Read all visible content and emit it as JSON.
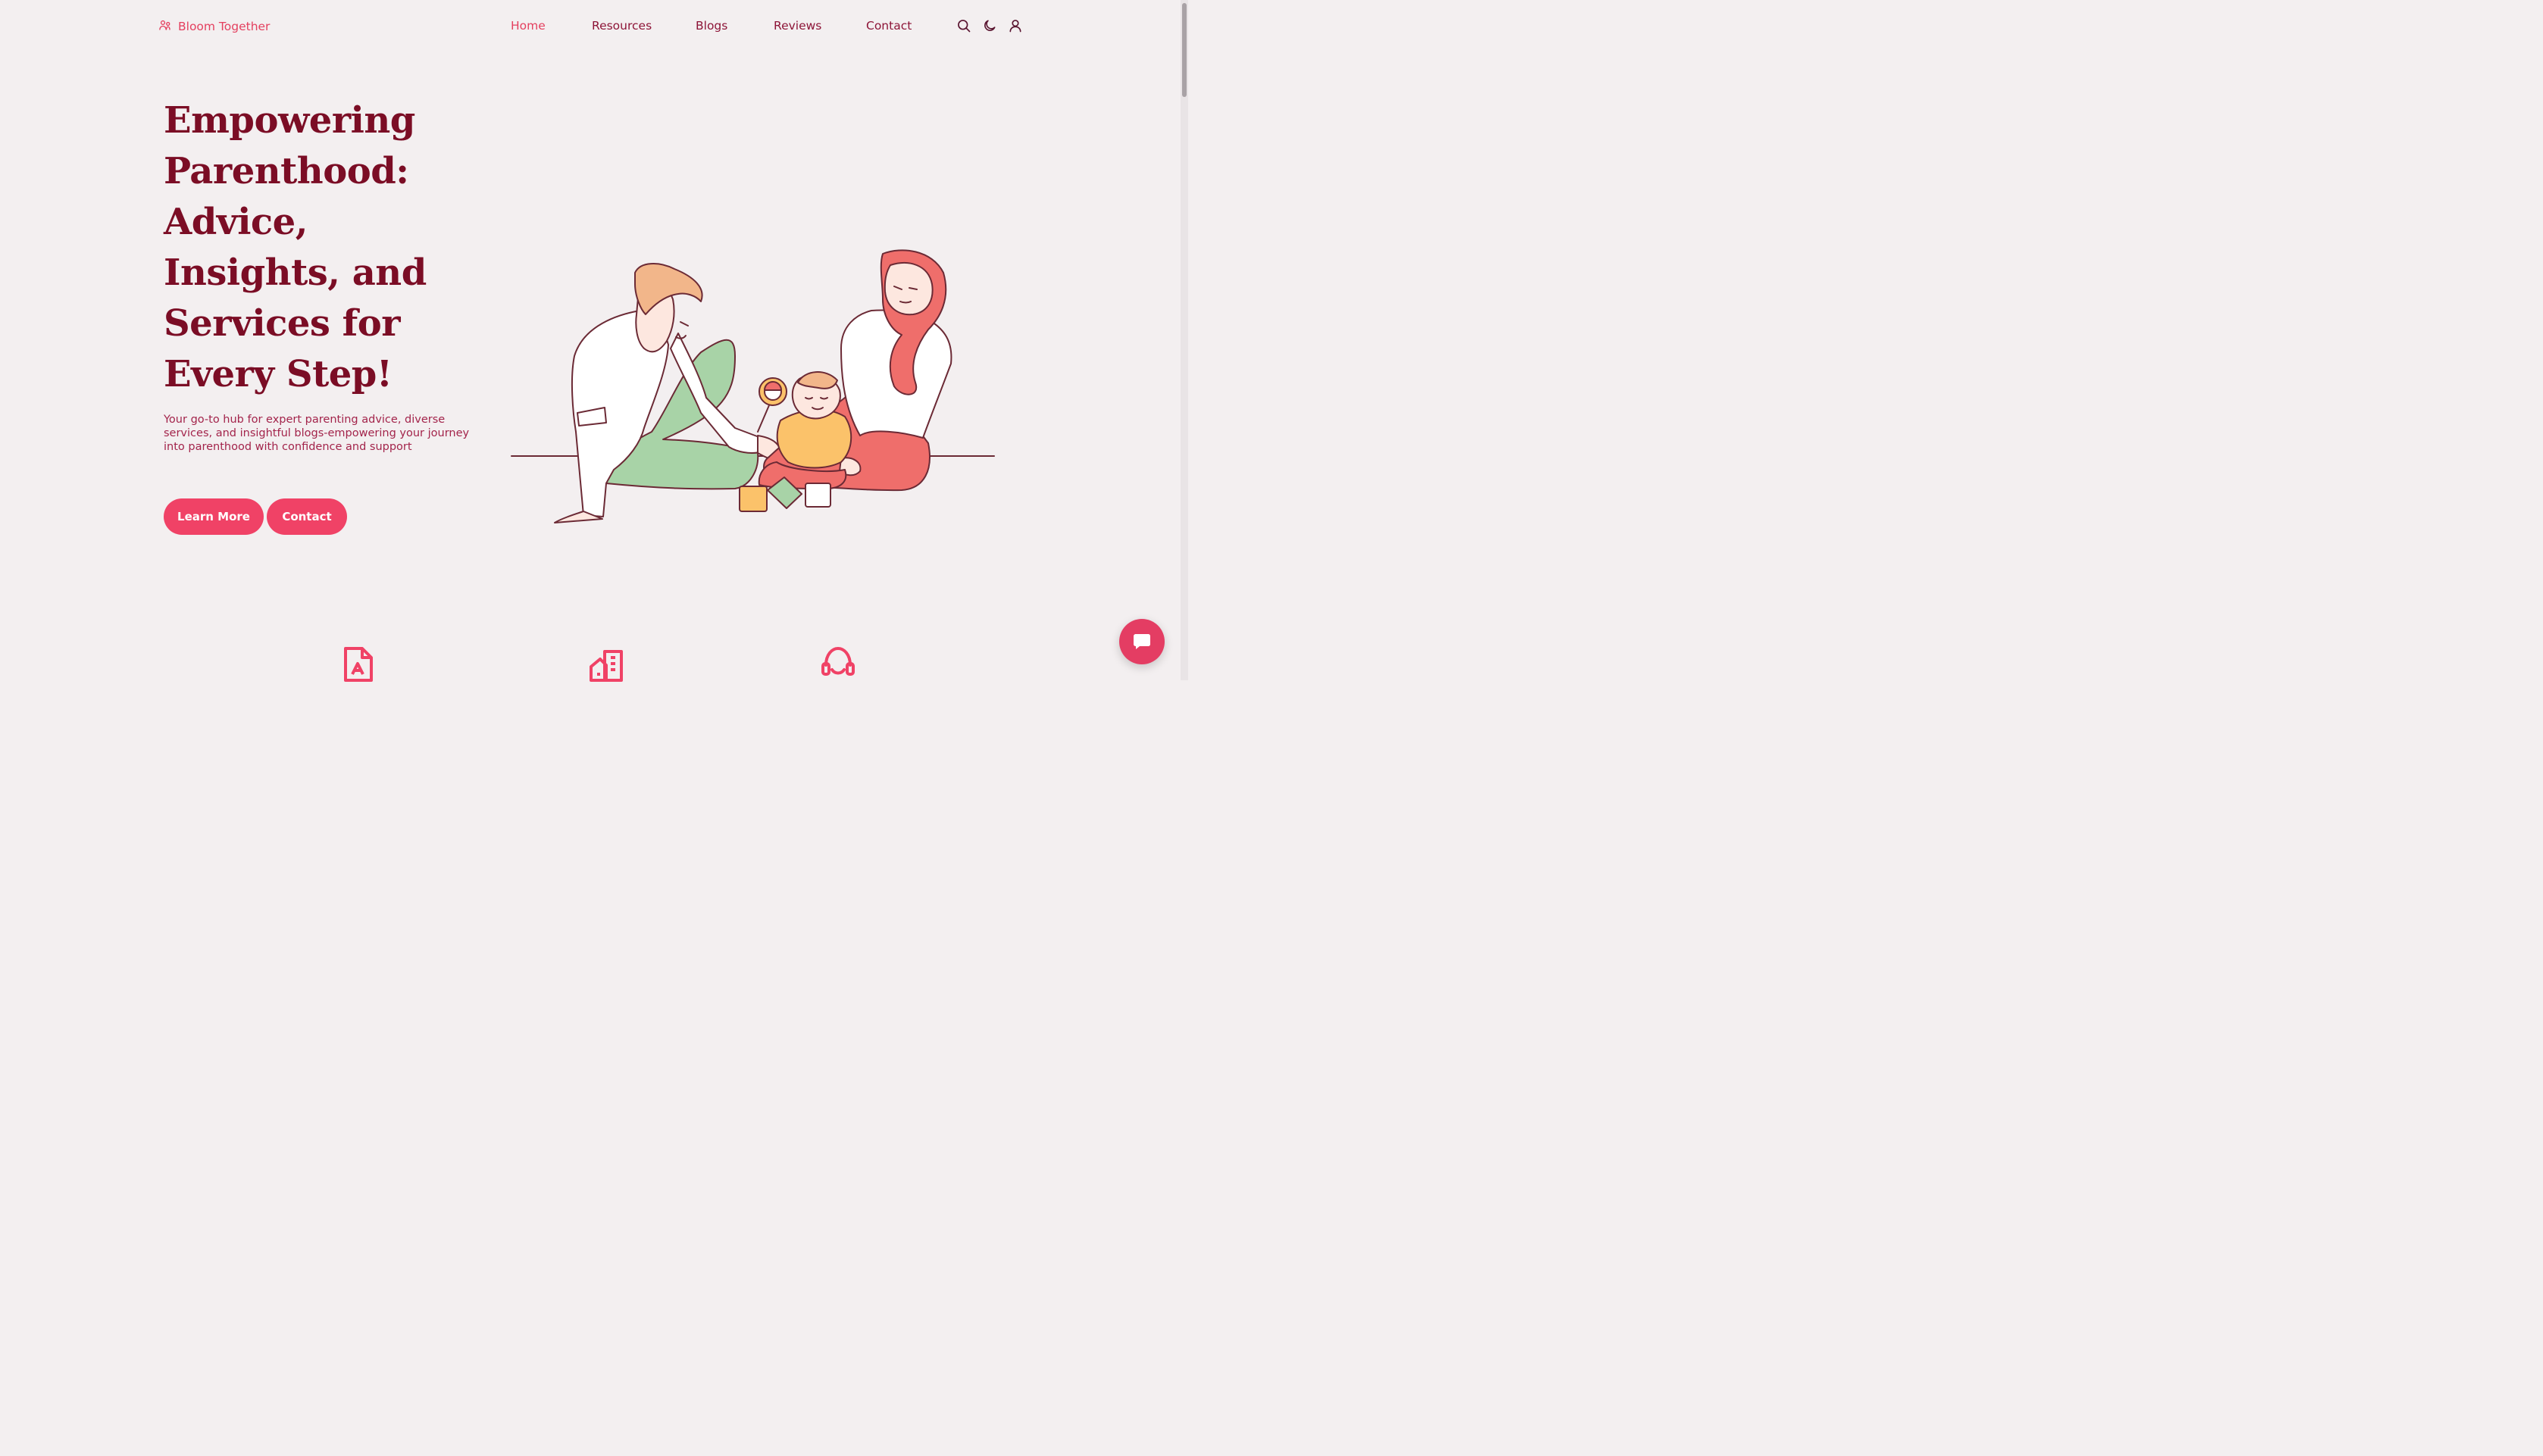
{
  "brand": {
    "name": "Bloom Together",
    "icon": "users-icon"
  },
  "nav": {
    "items": [
      {
        "label": "Home",
        "active": true
      },
      {
        "label": "Resources",
        "active": false
      },
      {
        "label": "Blogs",
        "active": false
      },
      {
        "label": "Reviews",
        "active": false
      },
      {
        "label": "Contact",
        "active": false
      }
    ],
    "icons": [
      "search-icon",
      "moon-icon",
      "user-icon"
    ]
  },
  "hero": {
    "title": "Empowering Parenthood: Advice, Insights, and Services for Every Step!",
    "subtitle": "Your go-to hub for expert parenting advice, diverse services, and insightful blogs-empowering your journey into parenthood with confidence and support",
    "buttons": {
      "learn_more": "Learn More",
      "contact": "Contact"
    },
    "illustration": "family-illustration"
  },
  "features": {
    "icons": [
      "pdf-document-icon",
      "buildings-icon",
      "headset-icon"
    ]
  },
  "chat": {
    "icon": "chat-bubble-icon"
  },
  "colors": {
    "background": "#f3eff0",
    "accent": "#f04266",
    "heading": "#7b0d25",
    "nav_text": "#8d1437",
    "nav_active": "#e4405f"
  }
}
